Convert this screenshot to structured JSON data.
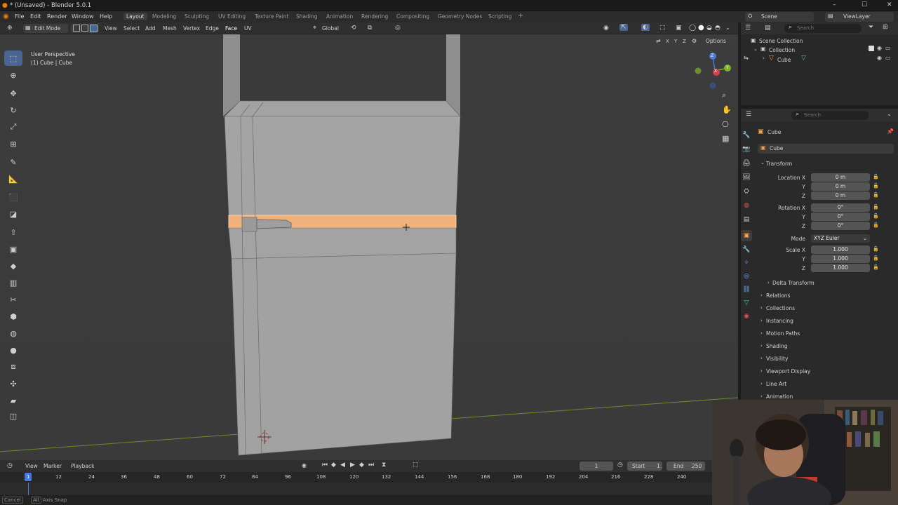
{
  "window": {
    "title": "* (Unsaved) - Blender 5.0.1",
    "controls": [
      "–",
      "☐",
      "✕"
    ]
  },
  "menu": {
    "items": [
      "File",
      "Edit",
      "Render",
      "Window",
      "Help"
    ]
  },
  "workspaces": {
    "tabs": [
      "Layout",
      "Modeling",
      "Sculpting",
      "UV Editing",
      "Texture Paint",
      "Shading",
      "Animation",
      "Rendering",
      "Compositing",
      "Geometry Nodes",
      "Scripting"
    ],
    "add": "+"
  },
  "topright": {
    "scene": "Scene",
    "view_layer": "ViewLayer"
  },
  "viewport_header": {
    "mode": "Edit Mode",
    "menus": [
      "View",
      "Select",
      "Add",
      "Mesh",
      "Vertex",
      "Edge",
      "Face",
      "UV"
    ],
    "orientation": "Global",
    "options": "Options"
  },
  "viewport": {
    "perspective": "User Perspective",
    "object_info": "(1) Cube | Cube",
    "axes": [
      "X",
      "Y",
      "Z"
    ],
    "gizmo": {
      "z": "Z",
      "x": "X",
      "y": "Y"
    }
  },
  "outliner": {
    "search_placeholder": "Search",
    "scene_collection": "Scene Collection",
    "collection": "Collection",
    "object": "Cube"
  },
  "properties": {
    "search_placeholder": "Search",
    "object_name": "Cube",
    "data_name": "Cube",
    "transform_label": "Transform",
    "location_label": "Location X",
    "location": {
      "x": "0 m",
      "y": "0 m",
      "z": "0 m"
    },
    "rotation_label": "Rotation X",
    "rotation": {
      "x": "0°",
      "y": "0°",
      "z": "0°"
    },
    "mode_label": "Mode",
    "mode_value": "XYZ Euler",
    "scale_label": "Scale X",
    "scale": {
      "x": "1.000",
      "y": "1.000",
      "z": "1.000"
    },
    "axis_y": "Y",
    "axis_z": "Z",
    "delta_transform": "Delta Transform",
    "sections": [
      "Relations",
      "Collections",
      "Instancing",
      "Motion Paths",
      "Shading",
      "Visibility",
      "Viewport Display",
      "Line Art",
      "Animation"
    ]
  },
  "timeline": {
    "menus": [
      "View",
      "Marker",
      "Playback"
    ],
    "current_frame": "1",
    "start_label": "Start",
    "start": "1",
    "end_label": "End",
    "end": "250",
    "ticks": [
      "1",
      "12",
      "24",
      "36",
      "48",
      "60",
      "72",
      "84",
      "96",
      "108",
      "120",
      "132",
      "144",
      "156",
      "168",
      "180",
      "192",
      "204",
      "216",
      "228",
      "240"
    ]
  },
  "status": {
    "cancel": "Cancel",
    "all": "All",
    "axis_snap": "Axis Snap"
  },
  "colors": {
    "accent": "#4a6591",
    "selection": "#f0b27a",
    "header": "#2f2f2f",
    "panel": "#2a2a2a"
  }
}
